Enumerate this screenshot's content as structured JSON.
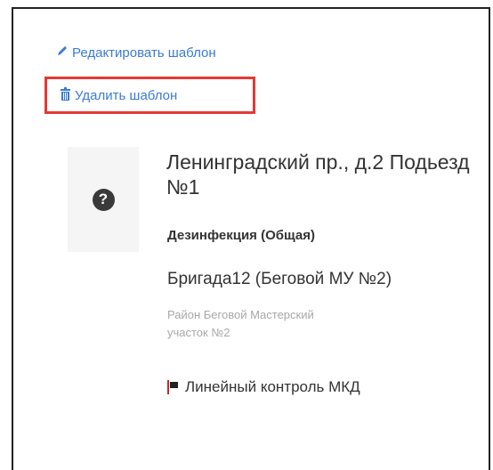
{
  "actions": {
    "edit_label": "Редактировать шаблон",
    "delete_label": "Удалить шаблон",
    "edit_icon": "pencil-icon",
    "delete_icon": "trash-icon"
  },
  "card": {
    "thumbnail_icon": "question-icon",
    "thumbnail_glyph": "?",
    "title": "Ленинградский пр., д.2 Подьезд №1",
    "service": "Дезинфекция (Общая)",
    "brigade": "Бригада12 (Беговой МУ №2)",
    "district": "Район Беговой Мастерский участок №2",
    "control_icon": "flag-icon",
    "control": "Линейный контроль МКД"
  },
  "colors": {
    "link": "#3a7bd5",
    "highlight_border": "#e53935",
    "muted_text": "#a8a8a8"
  }
}
